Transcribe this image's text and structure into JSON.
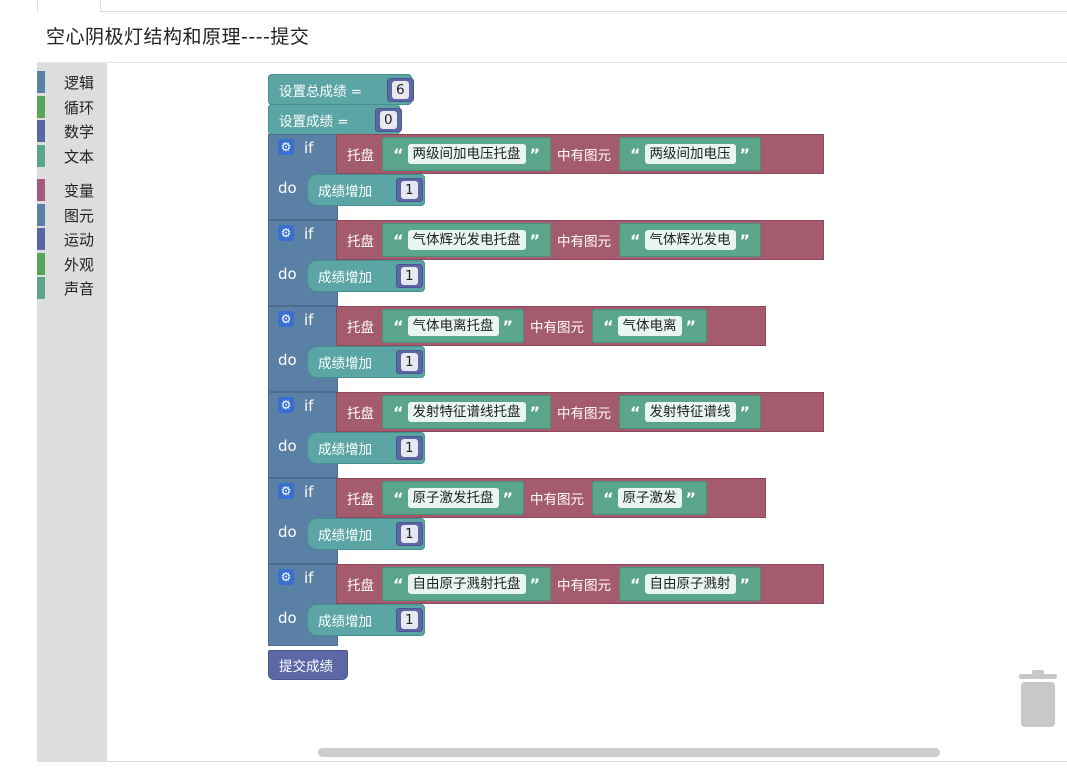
{
  "page": {
    "title": "空心阴极灯结构和原理----提交"
  },
  "toolbox": {
    "categories": [
      {
        "label": "逻辑",
        "color": "#5b80a5"
      },
      {
        "label": "循环",
        "color": "#5ba55b"
      },
      {
        "label": "数学",
        "color": "#5b67a5"
      },
      {
        "label": "文本",
        "color": "#5ba58c"
      },
      {
        "label": "变量",
        "color": "#a55b80"
      },
      {
        "label": "图元",
        "color": "#5b80a5"
      },
      {
        "label": "运动",
        "color": "#5b67a5"
      },
      {
        "label": "外观",
        "color": "#5ba55b"
      },
      {
        "label": "声音",
        "color": "#5ba58c"
      }
    ]
  },
  "blocks": {
    "set_total": {
      "label": "设置总成绩 =",
      "value": "6"
    },
    "set_score": {
      "label": "设置成绩 =",
      "value": "0"
    },
    "if_keyword": "if",
    "do_keyword": "do",
    "tray_label": "托盘",
    "has_label": "中有图元",
    "increase_label": "成绩增加",
    "rules": [
      {
        "tray": "两级间加电压托盘",
        "element": "两级间加电压",
        "increment": "1"
      },
      {
        "tray": "气体辉光发电托盘",
        "element": "气体辉光发电",
        "increment": "1"
      },
      {
        "tray": "气体电离托盘",
        "element": "气体电离",
        "increment": "1"
      },
      {
        "tray": "发射特征谱线托盘",
        "element": "发射特征谱线",
        "increment": "1"
      },
      {
        "tray": "原子激发托盘",
        "element": "原子激发",
        "increment": "1"
      },
      {
        "tray": "自由原子溅射托盘",
        "element": "自由原子溅射",
        "increment": "1"
      }
    ],
    "submit_label": "提交成绩"
  }
}
